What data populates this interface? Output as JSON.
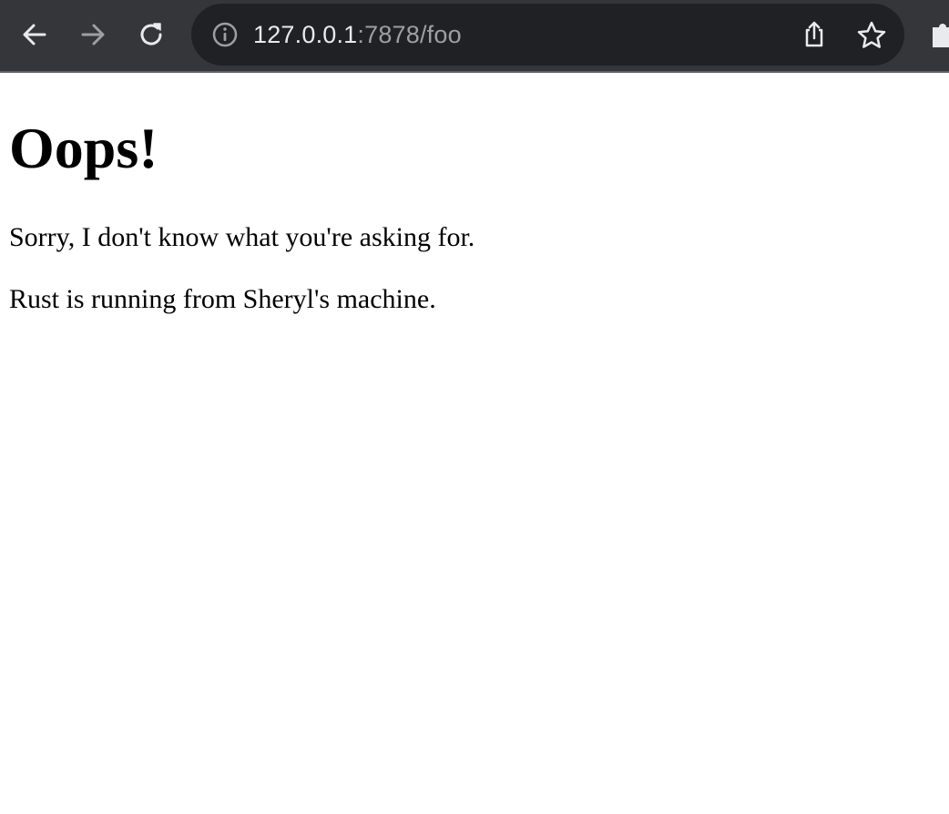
{
  "browser": {
    "url_host": "127.0.0.1",
    "url_rest": ":7878/foo",
    "icons": {
      "back": "arrow-left-icon",
      "forward": "arrow-right-icon",
      "reload": "reload-icon",
      "site_info": "info-icon",
      "share": "share-icon",
      "bookmark": "star-icon",
      "extensions": "puzzle-icon"
    },
    "colors": {
      "toolbar_bg": "#35363a",
      "omnibox_bg": "#202124",
      "icon": "#e8eaed",
      "icon_disabled": "#9aa0a6"
    }
  },
  "page": {
    "heading": "Oops!",
    "paragraphs": [
      "Sorry, I don't know what you're asking for.",
      "Rust is running from Sheryl's machine."
    ]
  }
}
